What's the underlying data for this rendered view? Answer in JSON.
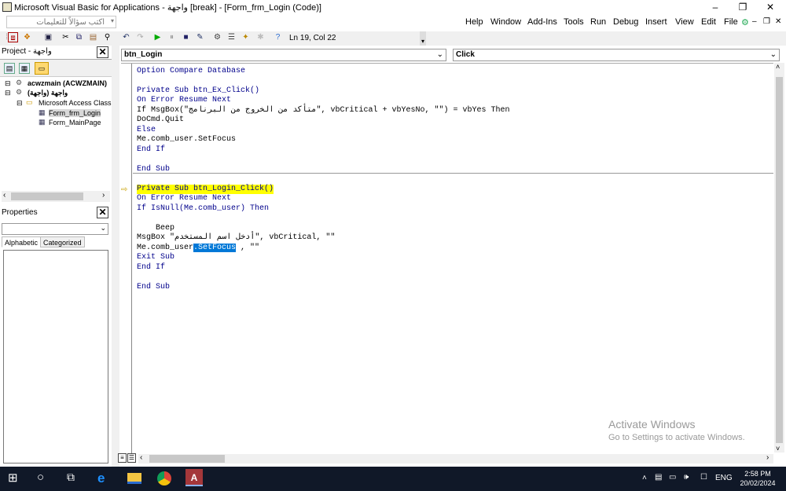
{
  "window": {
    "title": "Microsoft Visual Basic for Applications - واجهة [break] - [Form_frm_Login (Code)]",
    "controls": [
      "–",
      "❐",
      "✕"
    ]
  },
  "menubar": {
    "help_placeholder": "اكتب سؤالاً للتعليمات",
    "items": [
      "Help",
      "Window",
      "Add-Ins",
      "Tools",
      "Run",
      "Debug",
      "Insert",
      "View",
      "Edit",
      "File"
    ],
    "mdi_controls": [
      "–",
      "❐",
      "✕"
    ]
  },
  "toolbar": {
    "cursor_position": "Ln 19, Col 22"
  },
  "project_pane": {
    "title": "Project - واجهة",
    "tree": [
      {
        "label": "acwzmain (ACWZMAIN)",
        "bold": true
      },
      {
        "label": "واجهة (واجهة)",
        "bold": true
      },
      {
        "label": "Microsoft Access Class (",
        "bold": false
      },
      {
        "label": "Form_frm_Login",
        "bold": false
      },
      {
        "label": "Form_MainPage",
        "bold": false
      }
    ]
  },
  "properties_pane": {
    "title": "Properties",
    "tabs": [
      "Alphabetic",
      "Categorized"
    ]
  },
  "editor": {
    "object_select": "btn_Login",
    "procedure_select": "Click",
    "lines": {
      "l1": "Option Compare Database",
      "l3": "Private Sub btn_Ex_Click()",
      "l4": "On Error Resume Next",
      "l5_prefix": "If MsgBox(\"",
      "l5_arabic": "متأكد من الخروج من البرنامج",
      "l5_suffix": "\", vbCritical + vbYesNo, \"\") = vbYes Then",
      "l6": "DoCmd.Quit",
      "l7": "Else",
      "l8": "Me.comb_user.SetFocus",
      "l9": "End If",
      "l11": "End Sub",
      "l13": "Private Sub btn_Login_Click()",
      "l14": "On Error Resume Next",
      "l15": "If IsNull(Me.comb_user) Then",
      "l17": "    Beep",
      "l18_prefix": "MsgBox \"",
      "l18_arabic": "أدخل اسم المستخدم",
      "l18_suffix": "\", vbCritical, \"\"",
      "l19_prefix": "Me.comb_user",
      "l19_selected": ".SetFocus",
      "l19_suffix": " , \"\"",
      "l20": "Exit Sub",
      "l21": "End If",
      "l23": "End Sub"
    }
  },
  "watermark": {
    "line1": "Activate Windows",
    "line2": "Go to Settings to activate Windows."
  },
  "taskbar": {
    "language": "ENG",
    "time": "2:58 PM",
    "date": "20/02/2024"
  },
  "colors": {
    "keyword": "#00008b",
    "highlight": "#ffff00",
    "selection": "#0078d7",
    "taskbar": "#101828"
  }
}
